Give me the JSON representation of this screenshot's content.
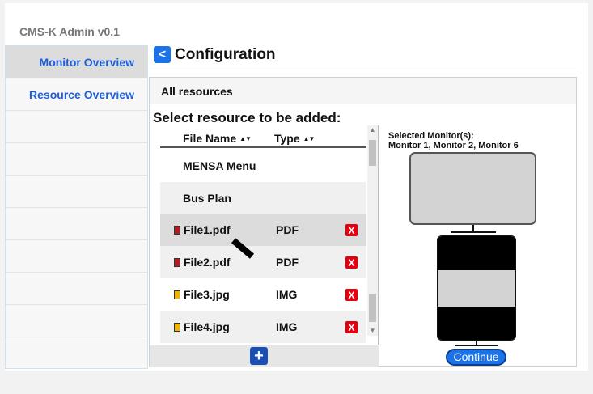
{
  "app": {
    "title": "CMS-K Admin v0.1"
  },
  "sidebar": {
    "items": [
      {
        "label": "Monitor Overview"
      },
      {
        "label": "Resource Overview"
      }
    ]
  },
  "header": {
    "back_icon": "<",
    "title": "Configuration"
  },
  "panel": {
    "header": "All resources",
    "select_label": "Select resource to be added:",
    "columns": {
      "name": "File Name",
      "type": "Type",
      "sort_icon": "▲▼"
    },
    "rows": [
      {
        "name": "MENSA Menu",
        "type": ""
      },
      {
        "name": "Bus Plan",
        "type": ""
      },
      {
        "name": "File1.pdf",
        "type": "PDF",
        "icon_color": "#b01e23"
      },
      {
        "name": "File2.pdf",
        "type": "PDF",
        "icon_color": "#b01e23"
      },
      {
        "name": "File3.jpg",
        "type": "IMG",
        "icon_color": "#f0b400"
      },
      {
        "name": "File4.jpg",
        "type": "IMG",
        "icon_color": "#f0b400"
      }
    ],
    "delete_icon": "X",
    "add_icon": "+"
  },
  "selection": {
    "label": "Selected Monitor(s):",
    "monitors": "Monitor 1, Monitor 2, Monitor 6"
  },
  "continue_label": "Continue",
  "colors": {
    "accent": "#1a73e8",
    "delete": "#e3000f",
    "nav_text": "#1d5fd6"
  }
}
